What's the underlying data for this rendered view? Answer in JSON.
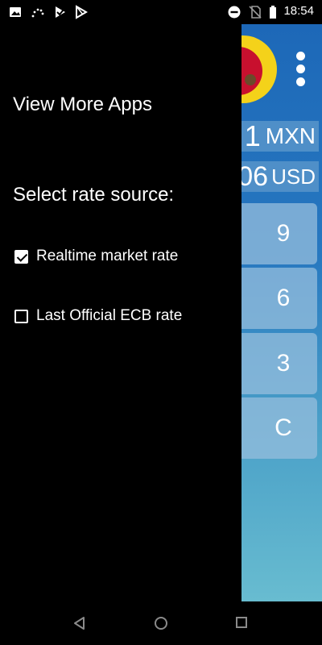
{
  "status_bar": {
    "left_icons": [
      "image-icon",
      "loading-icon",
      "play-store-notification-icon",
      "play-store-icon"
    ],
    "right_icons": [
      "do-not-disturb-icon",
      "no-sim-icon",
      "battery-icon"
    ],
    "time": "18:54"
  },
  "drawer": {
    "view_more_apps": "View More Apps",
    "select_rate_source": "Select rate source:",
    "options": [
      {
        "label": "Realtime market rate",
        "checked": true
      },
      {
        "label": "Last Official ECB rate",
        "checked": false
      }
    ]
  },
  "app_background": {
    "flag": "mexico-flag-icon",
    "rows": [
      {
        "amount": "1",
        "currency": "MXN"
      },
      {
        "amount": "06",
        "currency": "USD"
      }
    ],
    "keys": [
      "9",
      "6",
      "3",
      "C"
    ]
  },
  "nav_bar": {
    "buttons": [
      "back-icon",
      "home-icon",
      "recents-icon"
    ]
  }
}
